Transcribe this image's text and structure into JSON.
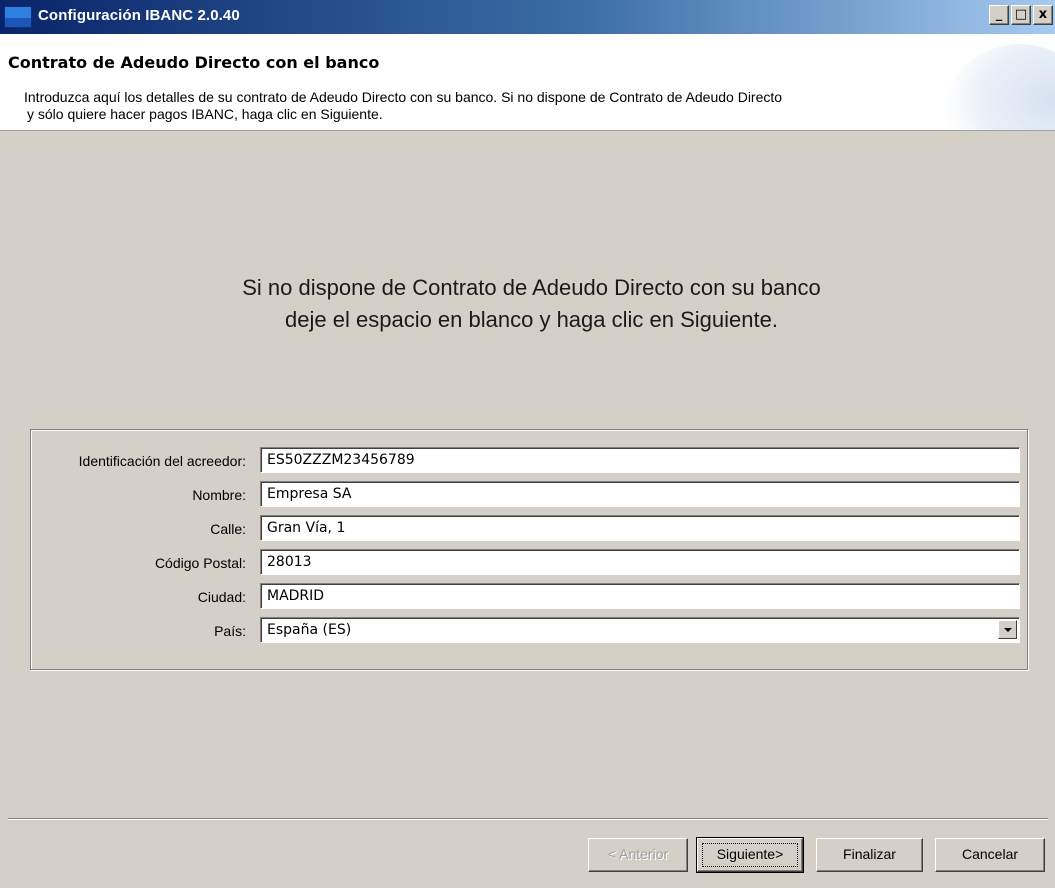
{
  "window": {
    "title": "Configuración IBANC 2.0.40",
    "controls": {
      "minimize": "_",
      "maximize": "□",
      "close": "x"
    }
  },
  "header": {
    "title": "Contrato de Adeudo Directo con el banco",
    "description_line1": "Introduzca aquí los detalles de su contrato de Adeudo Directo con su banco. Si no dispone de Contrato de Adeudo Directo",
    "description_line2": "y sólo quiere hacer pagos IBANC, haga clic en Siguiente."
  },
  "info": {
    "line1": "Si no dispone de Contrato de Adeudo Directo con su banco",
    "line2": "deje el espacio en blanco y haga clic en Siguiente."
  },
  "form": {
    "creditor_id": {
      "label": "Identificación del acreedor:",
      "value": "ES50ZZZM23456789"
    },
    "name": {
      "label": "Nombre:",
      "value": "Empresa SA"
    },
    "street": {
      "label": "Calle:",
      "value": "Gran Vía, 1"
    },
    "postal_code": {
      "label": "Código Postal:",
      "value": "28013"
    },
    "city": {
      "label": "Ciudad:",
      "value": "MADRID"
    },
    "country": {
      "label": "País:",
      "value": "España (ES)"
    }
  },
  "buttons": {
    "back": "< Anterior",
    "next": "Siguiente>",
    "finish": "Finalizar",
    "cancel": "Cancelar"
  }
}
